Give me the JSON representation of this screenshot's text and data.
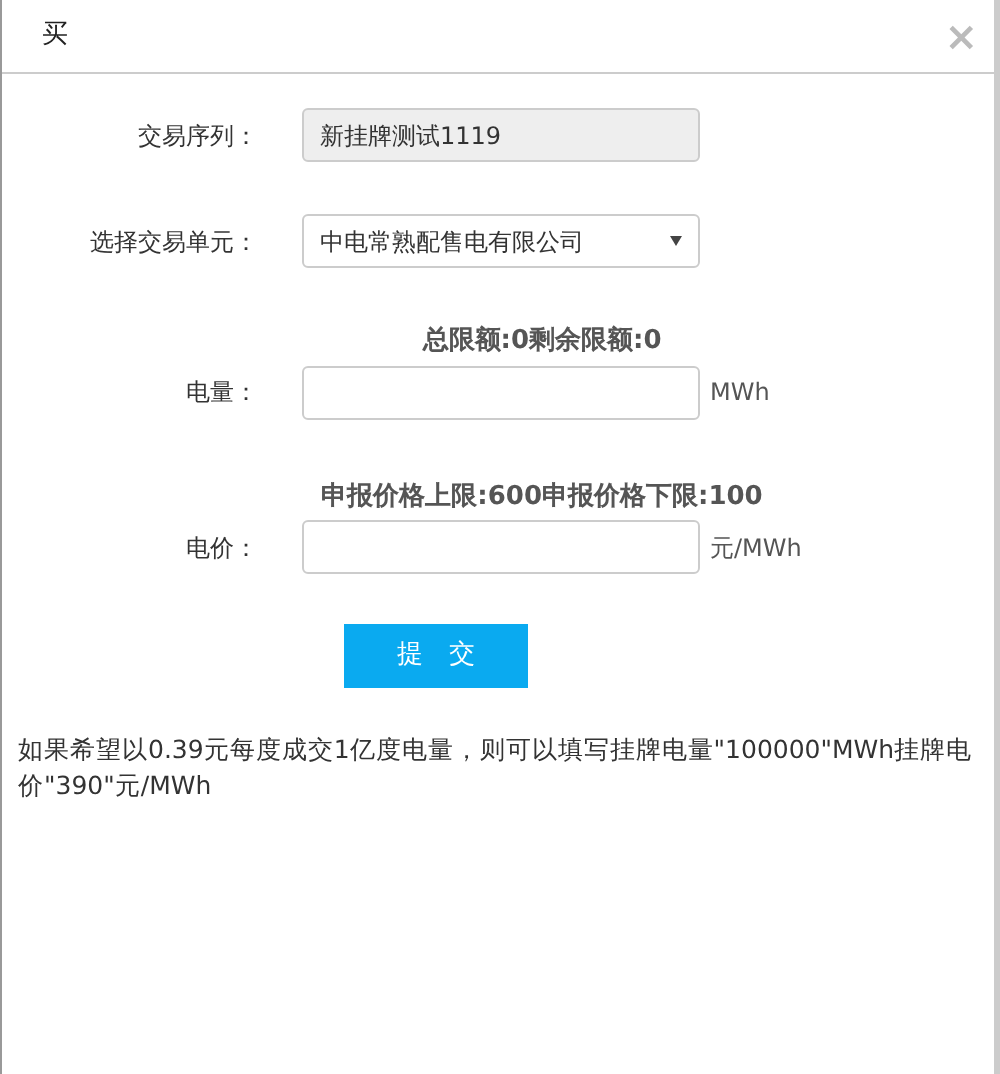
{
  "dialog": {
    "title": "买",
    "close": "×"
  },
  "fields": [
    {
      "kind": "readonly",
      "label": "交易序列：",
      "value": "新挂牌测试1119"
    },
    {
      "kind": "select",
      "label": "选择交易单元：",
      "value": "中电常熟配售电有限公司"
    },
    {
      "kind": "input",
      "hint": "总限额:0剩余限额:0",
      "label": "电量：",
      "unit": "MWh"
    },
    {
      "kind": "input",
      "hint": "申报价格上限:600申报价格下限:100",
      "label": "电价：",
      "unit": "元/MWh"
    }
  ],
  "submit": "提　交",
  "note": "如果希望以0.39元每度成交1亿度电量，则可以填写挂牌电量\"100000\"MWh挂牌电价\"390\"元/MWh"
}
